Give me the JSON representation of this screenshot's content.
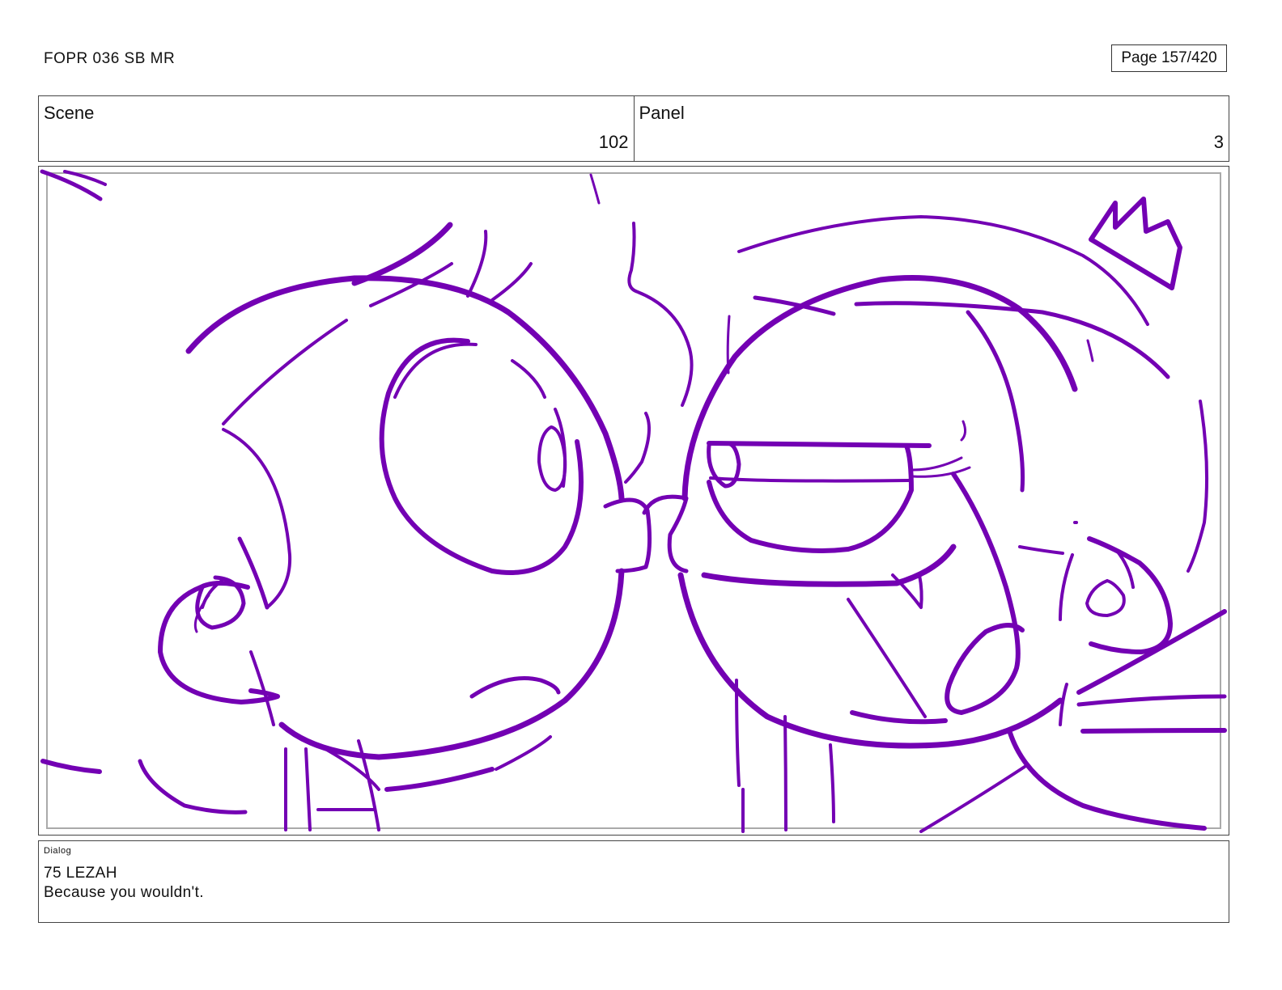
{
  "header": {
    "document_title": "FOPR 036 SB MR",
    "page_label": "Page 157/420"
  },
  "info": {
    "scene_label": "Scene",
    "scene_value": "102",
    "panel_label": "Panel",
    "panel_value": "3"
  },
  "dialog": {
    "label": "Dialog",
    "speaker": "75 LEZAH",
    "line": "Because you wouldn't."
  },
  "colors": {
    "sketch_stroke": "#7300b3",
    "safe_frame": "#aaaaaa"
  }
}
